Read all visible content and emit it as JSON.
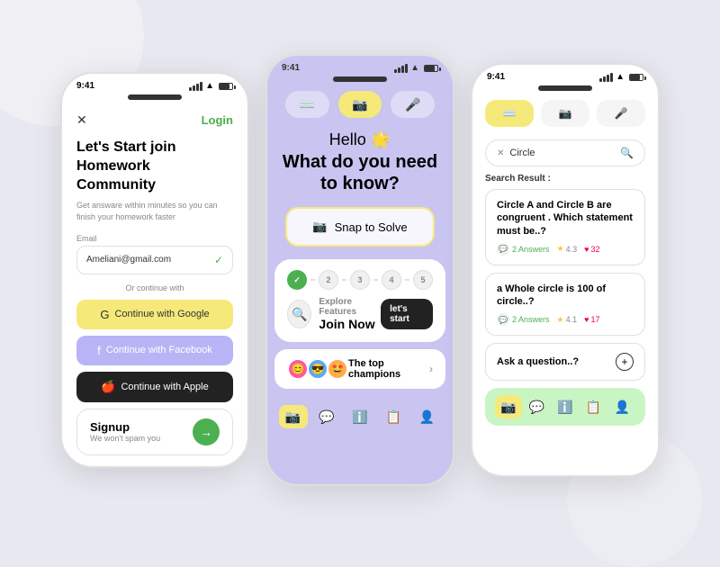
{
  "colors": {
    "green": "#4caf50",
    "yellow": "#f5e97a",
    "purple_bg": "#c9c4f0",
    "dark": "#222222",
    "facebook_purple": "#b8b4f5"
  },
  "phone1": {
    "time": "9:41",
    "close_label": "✕",
    "login_label": "Login",
    "title_line1": "Let's Start join",
    "title_line2": "Homework ",
    "title_bold": "Community",
    "subtitle": "Get answare within minutes so you can finish your homework faster",
    "email_label": "Email",
    "email_value": "Ameliani@gmail.com",
    "or_text": "Or continue with",
    "btn_google": "Continue with Google",
    "btn_facebook": "Continue with Facebook",
    "btn_apple": "Continue with Apple",
    "signup_title": "Signup",
    "signup_sub": "We won't spam you"
  },
  "phone2": {
    "time": "9:41",
    "hello": "Hello 🌟",
    "question": "What do you need to know?",
    "snap_btn": "Snap to Solve",
    "steps": [
      "✓",
      "2",
      "3",
      "4",
      "5"
    ],
    "explore_label": "Explore Features",
    "join_now": "Join Now",
    "start_btn": "let's start",
    "champions_text": "The top champions",
    "nav_items": [
      "📷",
      "💬",
      "ℹ️",
      "📋",
      "👤"
    ]
  },
  "phone3": {
    "time": "9:41",
    "search_value": "Circle",
    "result_label": "Search Result :",
    "card1_title": "Circle A and Circle B are congruent . Which statement must be..?",
    "card1_answers": "2 Answers",
    "card1_rating": "4.3",
    "card1_likes": "32",
    "card2_title": "a Whole circle is 100 of circle..?",
    "card2_answers": "2 Answers",
    "card2_rating": "4.1",
    "card2_likes": "17",
    "ask_text": "Ask a question..?",
    "nav_items": [
      "📷",
      "💬",
      "ℹ️",
      "📋",
      "👤"
    ]
  }
}
